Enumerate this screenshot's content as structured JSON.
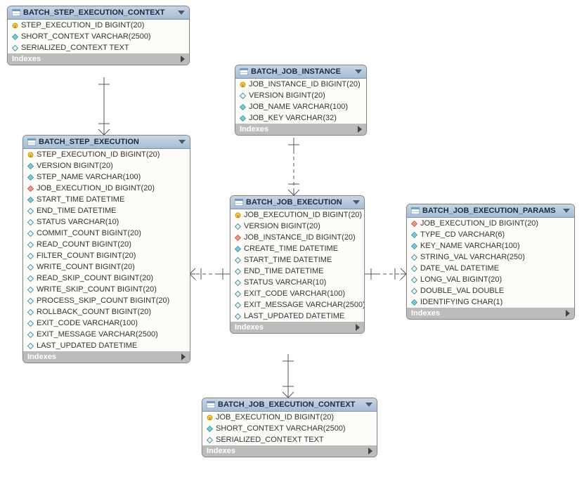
{
  "diagram": {
    "type": "entity-relationship",
    "tables": {
      "step_exec_ctx": {
        "title": "BATCH_STEP_EXECUTION_CONTEXT",
        "columns": [
          {
            "icon": "pk",
            "text": "STEP_EXECUTION_ID BIGINT(20)"
          },
          {
            "icon": "col",
            "text": "SHORT_CONTEXT VARCHAR(2500)"
          },
          {
            "icon": "open",
            "text": "SERIALIZED_CONTEXT TEXT"
          }
        ],
        "indexes_label": "Indexes"
      },
      "step_exec": {
        "title": "BATCH_STEP_EXECUTION",
        "columns": [
          {
            "icon": "pk",
            "text": "STEP_EXECUTION_ID BIGINT(20)"
          },
          {
            "icon": "col",
            "text": "VERSION BIGINT(20)"
          },
          {
            "icon": "col",
            "text": "STEP_NAME VARCHAR(100)"
          },
          {
            "icon": "fk",
            "text": "JOB_EXECUTION_ID BIGINT(20)"
          },
          {
            "icon": "col",
            "text": "START_TIME DATETIME"
          },
          {
            "icon": "open",
            "text": "END_TIME DATETIME"
          },
          {
            "icon": "open",
            "text": "STATUS VARCHAR(10)"
          },
          {
            "icon": "open",
            "text": "COMMIT_COUNT BIGINT(20)"
          },
          {
            "icon": "open",
            "text": "READ_COUNT BIGINT(20)"
          },
          {
            "icon": "open",
            "text": "FILTER_COUNT BIGINT(20)"
          },
          {
            "icon": "open",
            "text": "WRITE_COUNT BIGINT(20)"
          },
          {
            "icon": "open",
            "text": "READ_SKIP_COUNT BIGINT(20)"
          },
          {
            "icon": "open",
            "text": "WRITE_SKIP_COUNT BIGINT(20)"
          },
          {
            "icon": "open",
            "text": "PROCESS_SKIP_COUNT BIGINT(20)"
          },
          {
            "icon": "open",
            "text": "ROLLBACK_COUNT BIGINT(20)"
          },
          {
            "icon": "open",
            "text": "EXIT_CODE VARCHAR(100)"
          },
          {
            "icon": "open",
            "text": "EXIT_MESSAGE VARCHAR(2500)"
          },
          {
            "icon": "open",
            "text": "LAST_UPDATED DATETIME"
          }
        ],
        "indexes_label": "Indexes"
      },
      "job_instance": {
        "title": "BATCH_JOB_INSTANCE",
        "columns": [
          {
            "icon": "pk",
            "text": "JOB_INSTANCE_ID BIGINT(20)"
          },
          {
            "icon": "open",
            "text": "VERSION BIGINT(20)"
          },
          {
            "icon": "col",
            "text": "JOB_NAME VARCHAR(100)"
          },
          {
            "icon": "col",
            "text": "JOB_KEY VARCHAR(32)"
          }
        ],
        "indexes_label": "Indexes"
      },
      "job_exec": {
        "title": "BATCH_JOB_EXECUTION",
        "columns": [
          {
            "icon": "pk",
            "text": "JOB_EXECUTION_ID BIGINT(20)"
          },
          {
            "icon": "open",
            "text": "VERSION BIGINT(20)"
          },
          {
            "icon": "fk",
            "text": "JOB_INSTANCE_ID BIGINT(20)"
          },
          {
            "icon": "col",
            "text": "CREATE_TIME DATETIME"
          },
          {
            "icon": "open",
            "text": "START_TIME DATETIME"
          },
          {
            "icon": "open",
            "text": "END_TIME DATETIME"
          },
          {
            "icon": "open",
            "text": "STATUS VARCHAR(10)"
          },
          {
            "icon": "open",
            "text": "EXIT_CODE VARCHAR(100)"
          },
          {
            "icon": "open",
            "text": "EXIT_MESSAGE VARCHAR(2500)"
          },
          {
            "icon": "open",
            "text": "LAST_UPDATED DATETIME"
          }
        ],
        "indexes_label": "Indexes"
      },
      "job_exec_params": {
        "title": "BATCH_JOB_EXECUTION_PARAMS",
        "columns": [
          {
            "icon": "fk",
            "text": "JOB_EXECUTION_ID BIGINT(20)"
          },
          {
            "icon": "col",
            "text": "TYPE_CD VARCHAR(6)"
          },
          {
            "icon": "col",
            "text": "KEY_NAME VARCHAR(100)"
          },
          {
            "icon": "open",
            "text": "STRING_VAL VARCHAR(250)"
          },
          {
            "icon": "open",
            "text": "DATE_VAL DATETIME"
          },
          {
            "icon": "open",
            "text": "LONG_VAL BIGINT(20)"
          },
          {
            "icon": "open",
            "text": "DOUBLE_VAL DOUBLE"
          },
          {
            "icon": "col",
            "text": "IDENTIFYING CHAR(1)"
          }
        ],
        "indexes_label": "Indexes"
      },
      "job_exec_ctx": {
        "title": "BATCH_JOB_EXECUTION_CONTEXT",
        "columns": [
          {
            "icon": "pk",
            "text": "JOB_EXECUTION_ID BIGINT(20)"
          },
          {
            "icon": "col",
            "text": "SHORT_CONTEXT VARCHAR(2500)"
          },
          {
            "icon": "open",
            "text": "SERIALIZED_CONTEXT TEXT"
          }
        ],
        "indexes_label": "Indexes"
      }
    }
  }
}
